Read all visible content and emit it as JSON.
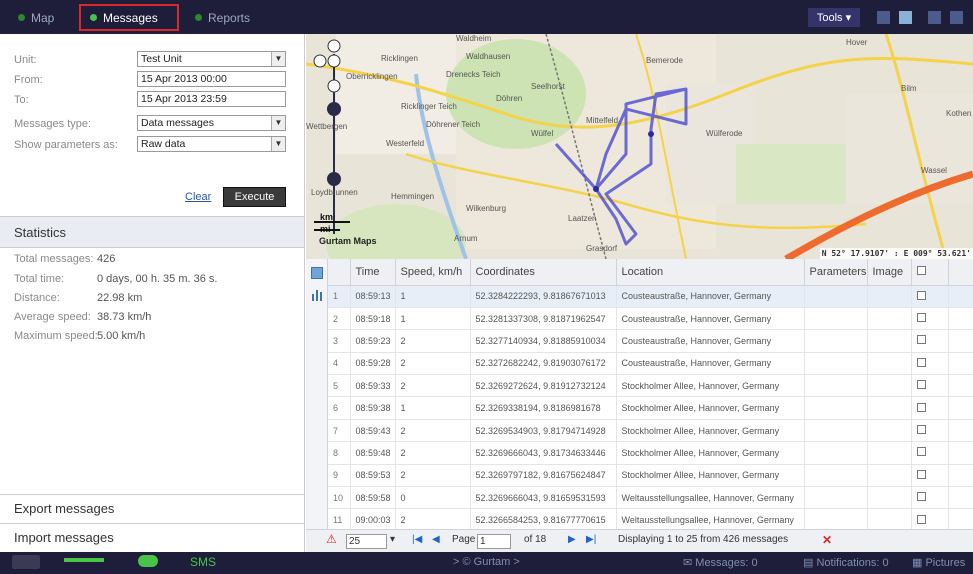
{
  "topbar": {
    "tabs": [
      {
        "label": "Map"
      },
      {
        "label": "Messages"
      },
      {
        "label": "Reports"
      }
    ],
    "tools_label": "Tools ▾"
  },
  "form": {
    "unit_label": "Unit:",
    "unit_value": "Test Unit",
    "from_label": "From:",
    "from_value": "15 Apr 2013 00:00",
    "to_label": "To:",
    "to_value": "15 Apr 2013 23:59",
    "msg_type_label": "Messages type:",
    "msg_type_value": "Data messages",
    "show_params_label": "Show parameters as:",
    "show_params_value": "Raw data",
    "clear_label": "Clear",
    "execute_label": "Execute"
  },
  "statistics": {
    "header": "Statistics",
    "rows": [
      {
        "label": "Total messages:",
        "value": "426"
      },
      {
        "label": "Total time:",
        "value": "0 days, 00 h. 35 m. 36 s."
      },
      {
        "label": "Distance:",
        "value": "22.98 km"
      },
      {
        "label": "Average speed:",
        "value": "38.73 km/h"
      },
      {
        "label": "Maximum speed:",
        "value": "5.00 km/h"
      }
    ]
  },
  "export_label": "Export messages",
  "import_label": "Import messages",
  "map": {
    "labels": [
      "Waldheim",
      "Ricklingen",
      "Oberricklingen",
      "Waldhausen",
      "Bemerode",
      "Hover",
      "Döhren",
      "Seelhorst",
      "Ricklinger Teich",
      "Döhrener Teich",
      "Mittelfeld",
      "Wettbergen",
      "Westerfeld",
      "Wülfel",
      "Wülferode",
      "Bilm",
      "Kothen",
      "Wassel",
      "Hemmingen",
      "Wilkenburg",
      "Laatzen",
      "Arnum",
      "Grasdorf",
      "Loydbrunnen",
      "Drenecks Teich"
    ],
    "scale_km": "km",
    "scale_mi": "mi",
    "copyright": "Gurtam Maps",
    "coords": "N 52° 17.9107' : E 009° 53.621'"
  },
  "table": {
    "columns": [
      "",
      "Time",
      "Speed, km/h",
      "Coordinates",
      "Location",
      "Parameters",
      "Image",
      ""
    ],
    "rows": [
      {
        "n": "1",
        "time": "08:59:13",
        "speed": "1",
        "coords": "52.3284222293, 9.81867671013",
        "location": "Cousteaustraße, Hannover, Germany"
      },
      {
        "n": "2",
        "time": "08:59:18",
        "speed": "1",
        "coords": "52.3281337308, 9.81871962547",
        "location": "Cousteaustraße, Hannover, Germany"
      },
      {
        "n": "3",
        "time": "08:59:23",
        "speed": "2",
        "coords": "52.3277140934, 9.81885910034",
        "location": "Cousteaustraße, Hannover, Germany"
      },
      {
        "n": "4",
        "time": "08:59:28",
        "speed": "2",
        "coords": "52.3272682242, 9.81903076172",
        "location": "Cousteaustraße, Hannover, Germany"
      },
      {
        "n": "5",
        "time": "08:59:33",
        "speed": "2",
        "coords": "52.3269272624, 9.81912732124",
        "location": "Stockholmer Allee, Hannover, Germany"
      },
      {
        "n": "6",
        "time": "08:59:38",
        "speed": "1",
        "coords": "52.3269338194, 9.8186981678",
        "location": "Stockholmer Allee, Hannover, Germany"
      },
      {
        "n": "7",
        "time": "08:59:43",
        "speed": "2",
        "coords": "52.3269534903, 9.81794714928",
        "location": "Stockholmer Allee, Hannover, Germany"
      },
      {
        "n": "8",
        "time": "08:59:48",
        "speed": "2",
        "coords": "52.3269666043, 9.81734633446",
        "location": "Stockholmer Allee, Hannover, Germany"
      },
      {
        "n": "9",
        "time": "08:59:53",
        "speed": "2",
        "coords": "52.3269797182, 9.81675624847",
        "location": "Stockholmer Allee, Hannover, Germany"
      },
      {
        "n": "10",
        "time": "08:59:58",
        "speed": "0",
        "coords": "52.3269666043, 9.81659531593",
        "location": "Weltausstellungsallee, Hannover, Germany"
      },
      {
        "n": "11",
        "time": "09:00:03",
        "speed": "2",
        "coords": "52.3266584253, 9.81677770615",
        "location": "Weltausstellungsallee, Hannover, Germany"
      }
    ]
  },
  "pager": {
    "page_size": "25",
    "page_label": "Page",
    "page_value": "1",
    "of_label": "of 18",
    "display_text": "Displaying 1 to 25 from 426 messages"
  },
  "statusbar": {
    "sms": "SMS",
    "gurtam": "> © Gurtam >",
    "messages": "Messages: 0",
    "notifications": "Notifications: 0",
    "pictures": "Pictures"
  },
  "colors": {
    "topbar": "#1e1d3a",
    "active_tab": "#49c449",
    "highlight_box": "#d9282a",
    "track": "#4a4ad0",
    "route_orange": "#ef6a2e"
  }
}
